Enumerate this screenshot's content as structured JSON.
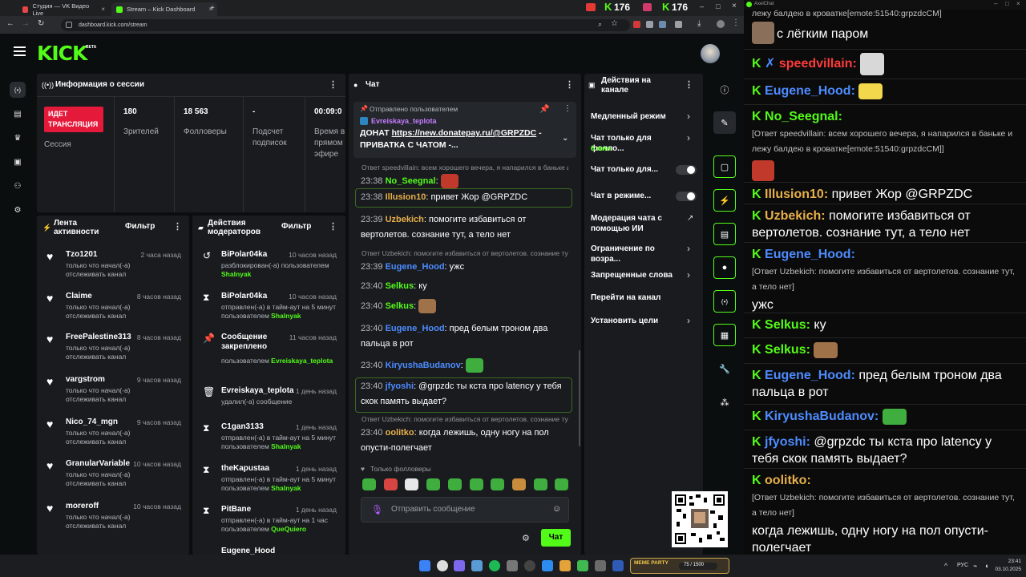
{
  "browser": {
    "tabs": [
      {
        "title": "Студия — VK Видео Live"
      },
      {
        "title": "Stream – Kick Dashboard"
      }
    ],
    "url": "dashboard.kick.com/stream",
    "counters": {
      "kick_viewers": "176",
      "live_viewers": "176"
    }
  },
  "kick": {
    "logo": "KICK",
    "beta": "BETA"
  },
  "session": {
    "title": "Информация о сессии",
    "live_badge": "ИДЕТ ТРАНСЛЯЦИЯ",
    "session_label": "Сессия",
    "viewers_value": "180",
    "viewers_label": "Зрителей",
    "followers_value": "18 563",
    "followers_label": "Фолловеры",
    "subs_value": "-",
    "subs_label": "Подсчет подписок",
    "uptime_value": "00:09:0",
    "uptime_label": "Время в прямом эфире"
  },
  "activity": {
    "title": "Лента активности",
    "filter": "Фильтр",
    "items": [
      {
        "name": "Tzo1201",
        "time": "2 часа назад",
        "desc": "только что начал(-а) отслеживать канал"
      },
      {
        "name": "Claime",
        "time": "8 часов назад",
        "desc": "только что начал(-а) отслеживать канал"
      },
      {
        "name": "FreePalestine313",
        "time": "8 часов назад",
        "desc": "только что начал(-а) отслеживать канал"
      },
      {
        "name": "vargstrom",
        "time": "9 часов назад",
        "desc": "только что начал(-а) отслеживать канал"
      },
      {
        "name": "Nico_74_mgn",
        "time": "9 часов назад",
        "desc": "только что начал(-а) отслеживать канал"
      },
      {
        "name": "GranularVariable",
        "time": "10 часов назад",
        "desc": "только что начал(-а) отслеживать канал"
      },
      {
        "name": "moreroff",
        "time": "10 часов назад",
        "desc": "только что начал(-а) отслеживать канал"
      }
    ]
  },
  "modactions": {
    "title": "Действия модераторов",
    "filter": "Фильтр",
    "items": [
      {
        "name": "BiPolar04ka",
        "time": "10 часов назад",
        "desc": "разблокирован(-а) пользователем",
        "by": "Shalnyak"
      },
      {
        "name": "BiPolar04ka",
        "time": "10 часов назад",
        "desc": "отправлен(-а) в тайм-аут на 5 минут пользователем",
        "by": "Shalnyak"
      },
      {
        "name": "Сообщение закреплено",
        "time": "11 часов назад",
        "desc": "пользователем",
        "by": "Evreiskaya_teplota"
      },
      {
        "name": "Evreiskaya_teplota",
        "time": "1 день назад",
        "desc": "удалил(-а) сообщение",
        "by": ""
      },
      {
        "name": "C1gan3133",
        "time": "1 день назад",
        "desc": "отправлен(-а) в тайм-аут на 5 минут пользователем",
        "by": "Shalnyak"
      },
      {
        "name": "theKapustaa",
        "time": "1 день назад",
        "desc": "отправлен(-а) в тайм-аут на 5 минут пользователем",
        "by": "Shalnyak"
      },
      {
        "name": "PitBane",
        "time": "1 день назад",
        "desc": "отправлен(-а) в тайм-аут на 1 час пользователем",
        "by": "QueQuiero"
      },
      {
        "name": "Eugene_Hood",
        "time": "",
        "desc": "",
        "by": ""
      }
    ]
  },
  "chat": {
    "title": "Чат",
    "pinned": {
      "label": "Отправлено пользователем",
      "user": "Evreiskaya_teplota",
      "text_prefix": "ДОНАТ ",
      "link": "https://new.donatepay.ru/@GRPZDC",
      "text_suffix": " - ПРИВАТКА С ЧАТОМ -..."
    },
    "messages": [
      {
        "reply": "Ответ speedvillain: всем хорошего вечера, я напарился в баньке и лежу балдею в кроватке[emote:51540:grpzdcCM]",
        "time": "23:38",
        "user": "No_Seegnal",
        "color": "#53fc18",
        "text": "",
        "emote": "#c0392b"
      },
      {
        "reply": "",
        "time": "23:38",
        "user": "Illusion10",
        "color": "#e8b04a",
        "text": "привет Жор @GRPZDC",
        "highlight": true
      },
      {
        "reply": "",
        "time": "23:39",
        "user": "Uzbekich",
        "color": "#e8b04a",
        "text": "помогите избавиться от вертолетов. сознание тут, а тело нет"
      },
      {
        "reply": "Ответ Uzbekich: помогите избавиться от вертолетов. сознание тут, а тело нет",
        "time": "23:39",
        "user": "Eugene_Hood",
        "color": "#4d8cff",
        "text": "ужс"
      },
      {
        "reply": "",
        "time": "23:40",
        "user": "Selkus",
        "color": "#53fc18",
        "text": "ку"
      },
      {
        "reply": "",
        "time": "23:40",
        "user": "Selkus",
        "color": "#53fc18",
        "text": "",
        "emote": "#a0724a"
      },
      {
        "reply": "",
        "time": "23:40",
        "user": "Eugene_Hood",
        "color": "#4d8cff",
        "text": "пред белым троном два пальца в рот"
      },
      {
        "reply": "",
        "time": "23:40",
        "user": "KiryushaBudanov",
        "color": "#4d8cff",
        "text": "",
        "emote": "#3fae3f"
      },
      {
        "reply": "",
        "time": "23:40",
        "user": "jfyoshi",
        "color": "#4d8cff",
        "text": "@grpzdc ты кста про latency у тебя скок память выдает?",
        "highlight": true
      },
      {
        "reply": "Ответ Uzbekich: помогите избавиться от вертолетов. сознание тут, а тело нет",
        "time": "23:40",
        "user": "oolitko",
        "color": "#e8b04a",
        "text": "когда лежишь, одну ногу на пол опусти-полегчает"
      }
    ],
    "followers_only": "Только фолловеры",
    "input_placeholder": "Отправить сообщение",
    "send": "Чат"
  },
  "actions": {
    "title": "Действия на канале",
    "items": [
      {
        "label": "Медленный режим",
        "sub": "",
        "ctl": "chev"
      },
      {
        "label": "Чат только для фолло...",
        "sub": "6 мин",
        "ctl": "chev"
      },
      {
        "label": "Чат только для...",
        "sub": "",
        "ctl": "toggle"
      },
      {
        "label": "Чат в режиме...",
        "sub": "",
        "ctl": "toggle"
      },
      {
        "label": "Модерация чата с помощью ИИ",
        "sub": "",
        "ctl": "ext"
      },
      {
        "label": "Ограничение по возра...",
        "sub": "",
        "ctl": "chev"
      },
      {
        "label": "Запрещенные слова",
        "sub": "",
        "ctl": "chev"
      },
      {
        "label": "Перейти на канал",
        "sub": "",
        "ctl": ""
      },
      {
        "label": "Установить цели",
        "sub": "",
        "ctl": "chev"
      }
    ]
  },
  "axelchat": {
    "title": "AxelChat",
    "top_text": "лежу балдею в кроватке[emote:51540:grpzdcCM]",
    "line1": "с лёгким паром",
    "messages": [
      {
        "user": "speedvillain:",
        "color": "#ff3b3b",
        "reply": "",
        "text": "",
        "emote": "#d8d8d8"
      },
      {
        "user": "Eugene_Hood:",
        "color": "#4d8cff",
        "reply": "",
        "text": "",
        "emote": "#f2d64b"
      },
      {
        "user": "No_Seegnal:",
        "color": "#53fc18",
        "reply": "[Ответ speedvillain: всем хорошего вечера, я напарился в баньке и лежу балдею в кроватке[emote:51540:grpzdcCM]]",
        "text": "",
        "emote": "#c0392b"
      },
      {
        "user": "Illusion10:",
        "color": "#e8b04a",
        "reply": "",
        "text": "привет Жор @GRPZDC"
      },
      {
        "user": "Uzbekich:",
        "color": "#e8b04a",
        "reply": "",
        "text": "помогите избавиться от вертолетов. сознание тут, а тело нет"
      },
      {
        "user": "Eugene_Hood:",
        "color": "#4d8cff",
        "reply": "[Ответ Uzbekich: помогите избавиться от вертолетов. сознание тут, а тело нет]",
        "text": "ужс"
      },
      {
        "user": "Selkus:",
        "color": "#53fc18",
        "reply": "",
        "text": "ку"
      },
      {
        "user": "Selkus:",
        "color": "#53fc18",
        "reply": "",
        "text": "",
        "emote": "#a0724a"
      },
      {
        "user": "Eugene_Hood:",
        "color": "#4d8cff",
        "reply": "",
        "text": "пред белым троном два пальца в рот"
      },
      {
        "user": "KiryushaBudanov:",
        "color": "#4d8cff",
        "reply": "",
        "text": "",
        "emote": "#3fae3f"
      },
      {
        "user": "jfyoshi:",
        "color": "#4d8cff",
        "reply": "",
        "text": "@grpzdc ты кста про latency у тебя скок память выдает?"
      },
      {
        "user": "oolitko:",
        "color": "#e8b04a",
        "reply": "[Ответ Uzbekich: помогите избавиться от вертолетов. сознание тут, а тело нет]",
        "text": "когда лежишь, одну ногу на пол опусти-полегчает"
      }
    ]
  },
  "overlay": {
    "goal_label": "MEME PARTY",
    "goal_value": "75 / 1500"
  },
  "taskbar": {
    "lang": "РУС",
    "time": "23:41",
    "date": "03.10.2025"
  }
}
